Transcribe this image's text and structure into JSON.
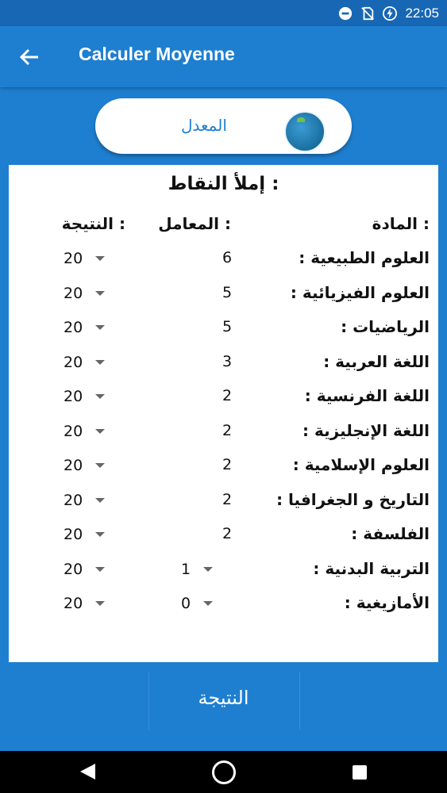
{
  "status": {
    "time": "22:05"
  },
  "appbar": {
    "title": "Calculer Moyenne"
  },
  "pill": {
    "label": "المعدل"
  },
  "form": {
    "title": "إملأ النقاط :",
    "headers": {
      "subject": "المادة :",
      "coefficient": "المعامل :",
      "result": "النتيجة :"
    },
    "rows": [
      {
        "subject": "العلوم الطبيعية :",
        "coefficient": "6",
        "score": "20"
      },
      {
        "subject": "العلوم الفيزيائية :",
        "coefficient": "5",
        "score": "20"
      },
      {
        "subject": "الرياضيات :",
        "coefficient": "5",
        "score": "20"
      },
      {
        "subject": "اللغة العربية :",
        "coefficient": "3",
        "score": "20"
      },
      {
        "subject": "اللغة الفرنسية :",
        "coefficient": "2",
        "score": "20"
      },
      {
        "subject": "اللغة الإنجليزية :",
        "coefficient": "2",
        "score": "20"
      },
      {
        "subject": "العلوم الإسلامية :",
        "coefficient": "2",
        "score": "20"
      },
      {
        "subject": "التاريخ و الجغرافيا :",
        "coefficient": "2",
        "score": "20"
      },
      {
        "subject": "الفلسفة :",
        "coefficient": "2",
        "score": "20"
      },
      {
        "subject": "التربية البدنية :",
        "coefficient": "1",
        "score": "20"
      },
      {
        "subject": "الأمازيغية :",
        "coefficient": "0",
        "score": "20"
      }
    ]
  },
  "bottom_button": {
    "label": "النتيجة"
  },
  "icons": {
    "status": [
      "do-not-disturb-icon",
      "no-sim-icon",
      "battery-charging-icon"
    ],
    "back": "arrow-back-icon",
    "nav": [
      "nav-back-icon",
      "nav-home-icon",
      "nav-recent-icon"
    ]
  },
  "colors": {
    "primary": "#1e7fd0",
    "status_bar": "#1767b4",
    "accent_text": "#1e7fd0"
  }
}
